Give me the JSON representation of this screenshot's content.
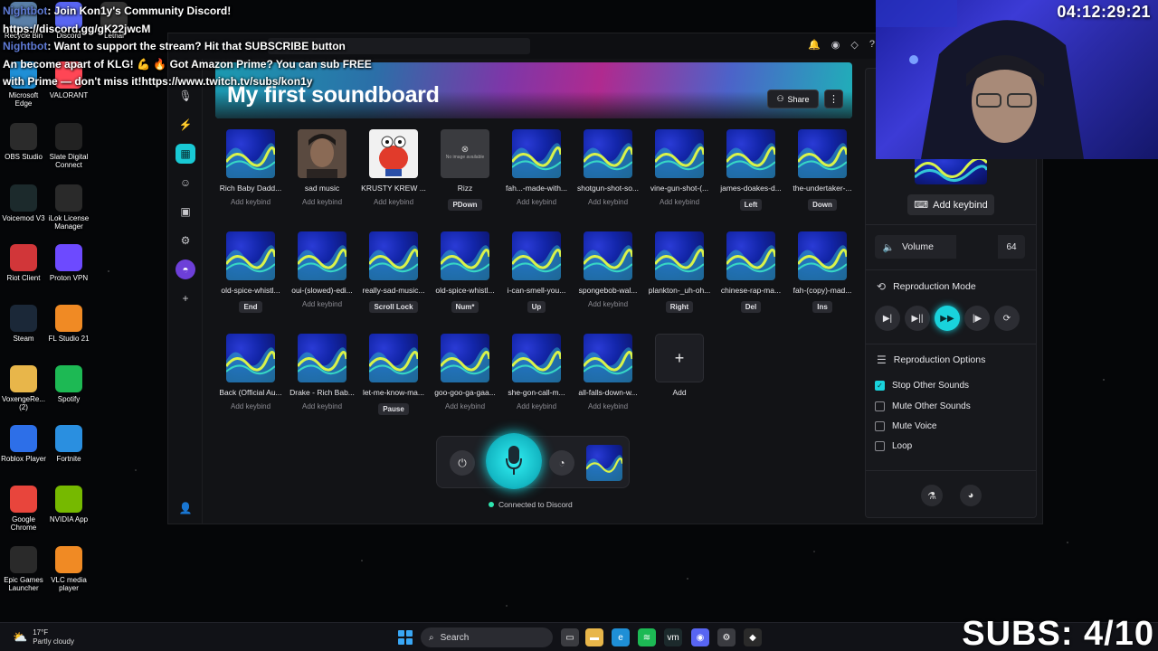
{
  "chat": [
    {
      "nick": "Nightbot",
      "text": ": Join Kon1y's Community Discord!"
    },
    {
      "nick": "",
      "text": "https://discord.gg/gK22jwcM"
    },
    {
      "nick": "Nightbot",
      "text": ": Want to support the stream? Hit that SUBSCRIBE button"
    },
    {
      "nick": "",
      "text": "An become apart of KLG! 💪 🔥 Got Amazon Prime? You can sub FREE"
    },
    {
      "nick": "",
      "text": "with Prime — don't miss it!https://www.twitch.tv/subs/kon1y"
    }
  ],
  "desktop_icons": [
    {
      "label": "Recycle Bin",
      "icon": "recycle-bin-icon",
      "color": "#5a7fa8"
    },
    {
      "label": "Discord",
      "icon": "discord-icon",
      "color": "#5865f2"
    },
    {
      "label": "Lethal",
      "icon": "game-icon",
      "color": "#333333"
    },
    {
      "label": "Microsoft Edge",
      "icon": "edge-icon",
      "color": "#1f8fd6"
    },
    {
      "label": "VALORANT",
      "icon": "valorant-icon",
      "color": "#ff4655"
    },
    {
      "label": "OBS Studio",
      "icon": "obs-icon",
      "color": "#2b2b2b"
    },
    {
      "label": "Slate Digital Connect",
      "icon": "slate-icon",
      "color": "#222222"
    },
    {
      "label": "Voicemod V3",
      "icon": "voicemod-icon",
      "color": "#1c2a2c"
    },
    {
      "label": "iLok License Manager",
      "icon": "ilok-icon",
      "color": "#2a2a2a"
    },
    {
      "label": "Riot Client",
      "icon": "riot-icon",
      "color": "#d13639"
    },
    {
      "label": "Proton VPN",
      "icon": "proton-icon",
      "color": "#6d4aff"
    },
    {
      "label": "Steam",
      "icon": "steam-icon",
      "color": "#1b2838"
    },
    {
      "label": "FL Studio 21",
      "icon": "fl-studio-icon",
      "color": "#f08a24"
    },
    {
      "label": "VoxengeRe... (2)",
      "icon": "folder-icon",
      "color": "#e8b64a"
    },
    {
      "label": "Spotify",
      "icon": "spotify-icon",
      "color": "#1db954"
    },
    {
      "label": "Roblox Player",
      "icon": "roblox-icon",
      "color": "#2d6fe8"
    },
    {
      "label": "Fortnite",
      "icon": "fortnite-icon",
      "color": "#2a8fe0"
    },
    {
      "label": "Google Chrome",
      "icon": "chrome-icon",
      "color": "#e8453c"
    },
    {
      "label": "NVIDIA App",
      "icon": "nvidia-icon",
      "color": "#76b900"
    },
    {
      "label": "Epic Games Launcher",
      "icon": "epic-icon",
      "color": "#2a2a2a"
    },
    {
      "label": "VLC media player",
      "icon": "vlc-icon",
      "color": "#f08a24"
    }
  ],
  "app": {
    "board_title": "My first soundboard",
    "share_label": "Share",
    "connection_status": "Connected to Discord",
    "accent": "#19d3dc"
  },
  "sounds": [
    {
      "name": "Rich Baby Dadd...",
      "key": "Add keybind",
      "bound": false,
      "thumb": "wave"
    },
    {
      "name": "sad music",
      "key": "Add keybind",
      "bound": false,
      "thumb": "photo"
    },
    {
      "name": "KRUSTY KREW ...",
      "key": "Add keybind",
      "bound": false,
      "thumb": "crab"
    },
    {
      "name": "Rizz",
      "key": "PDown",
      "bound": true,
      "thumb": "noimg"
    },
    {
      "name": "fah...-made-with...",
      "key": "Add keybind",
      "bound": false,
      "thumb": "wave"
    },
    {
      "name": "shotgun-shot-so...",
      "key": "Add keybind",
      "bound": false,
      "thumb": "wave"
    },
    {
      "name": "vine-gun-shot-(...",
      "key": "Add keybind",
      "bound": false,
      "thumb": "wave"
    },
    {
      "name": "james-doakes-d...",
      "key": "Left",
      "bound": true,
      "thumb": "wave"
    },
    {
      "name": "the-undertaker-...",
      "key": "Down",
      "bound": true,
      "thumb": "wave"
    },
    {
      "name": "old-spice-whistl...",
      "key": "End",
      "bound": true,
      "thumb": "wave"
    },
    {
      "name": "oui-(slowed)-edi...",
      "key": "Add keybind",
      "bound": false,
      "thumb": "wave"
    },
    {
      "name": "really-sad-music...",
      "key": "Scroll Lock",
      "bound": true,
      "thumb": "wave"
    },
    {
      "name": "old-spice-whistl...",
      "key": "Num*",
      "bound": true,
      "thumb": "wave"
    },
    {
      "name": "i-can-smell-you...",
      "key": "Up",
      "bound": true,
      "thumb": "wave"
    },
    {
      "name": "spongebob-wal...",
      "key": "Add keybind",
      "bound": false,
      "thumb": "wave"
    },
    {
      "name": "plankton-_uh-oh...",
      "key": "Right",
      "bound": true,
      "thumb": "wave"
    },
    {
      "name": "chinese-rap-ma...",
      "key": "Del",
      "bound": true,
      "thumb": "wave"
    },
    {
      "name": "fah-(copy)-mad...",
      "key": "Ins",
      "bound": true,
      "thumb": "wave"
    },
    {
      "name": "Back (Official Au...",
      "key": "Add keybind",
      "bound": false,
      "thumb": "wave"
    },
    {
      "name": "Drake - Rich Bab...",
      "key": "Add keybind",
      "bound": false,
      "thumb": "wave"
    },
    {
      "name": "let-me-know-ma...",
      "key": "Pause",
      "bound": true,
      "thumb": "wave"
    },
    {
      "name": "goo-goo-ga-gaa...",
      "key": "Add keybind",
      "bound": false,
      "thumb": "wave"
    },
    {
      "name": "she-gon-call-m...",
      "key": "Add keybind",
      "bound": false,
      "thumb": "wave"
    },
    {
      "name": "all-falls-down-w...",
      "key": "Add keybind",
      "bound": false,
      "thumb": "wave"
    }
  ],
  "add_tile_label": "Add",
  "no_image_text": "No image available",
  "right_panel": {
    "add_keybind": "Add keybind",
    "volume_label": "Volume",
    "volume_value": "64",
    "repro_mode_title": "Reproduction Mode",
    "repro_options_title": "Reproduction Options",
    "options": [
      {
        "label": "Stop Other Sounds",
        "checked": true
      },
      {
        "label": "Mute Other Sounds",
        "checked": false
      },
      {
        "label": "Mute Voice",
        "checked": false
      },
      {
        "label": "Loop",
        "checked": false
      }
    ]
  },
  "overlay": {
    "clock": "04:12:29:21",
    "subs": "SUBS: 4/10"
  },
  "taskbar": {
    "temp": "17°F",
    "weather": "Partly cloudy",
    "search_label": "Search"
  }
}
